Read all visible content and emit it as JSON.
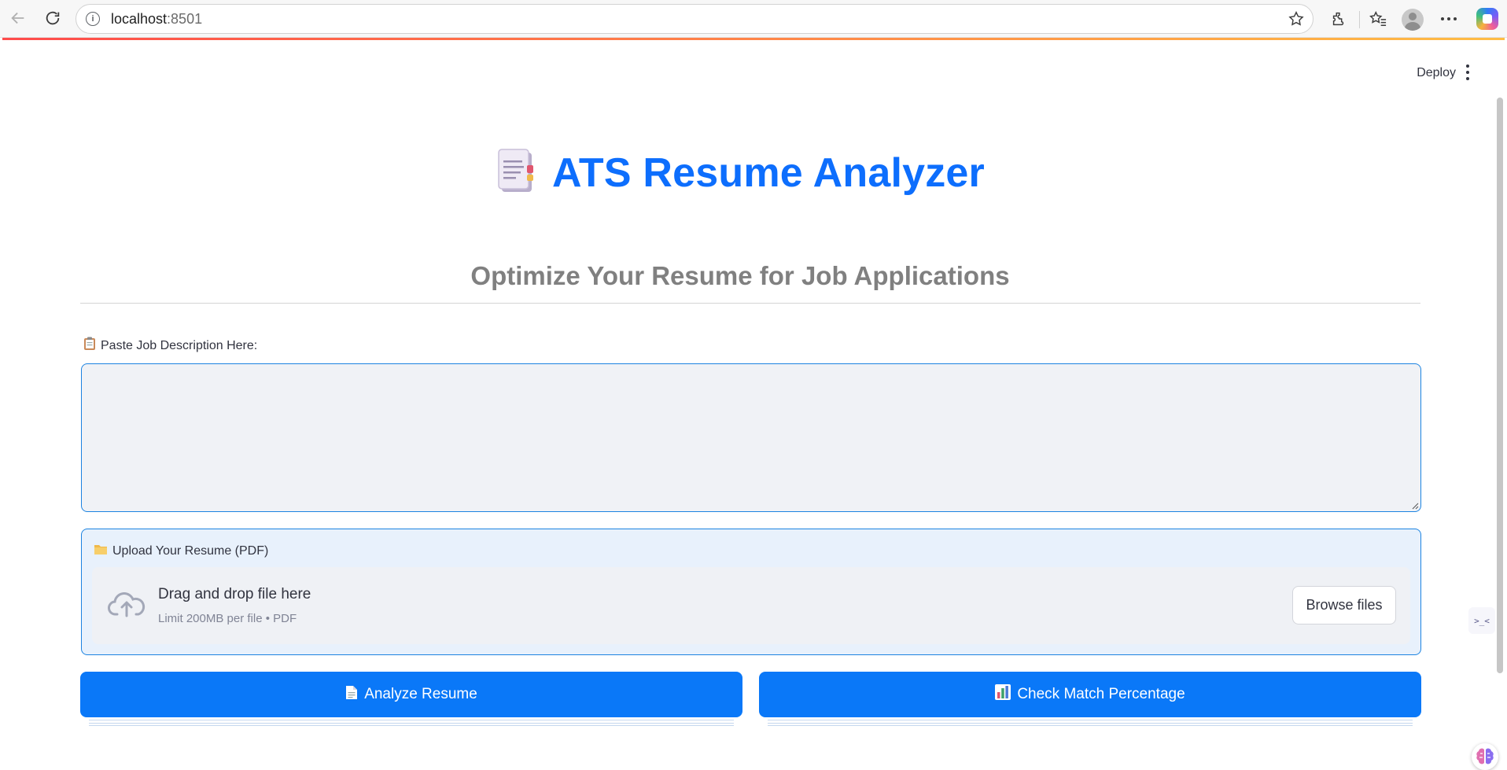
{
  "browser": {
    "url_host": "localhost",
    "url_port": ":8501"
  },
  "header": {
    "deploy_label": "Deploy"
  },
  "main": {
    "title": "ATS Resume Analyzer",
    "subtitle": "Optimize Your Resume for Job Applications",
    "job_description": {
      "label": "Paste Job Description Here:",
      "value": ""
    },
    "uploader": {
      "label": "Upload Your Resume (PDF)",
      "drop_text": "Drag and drop file here",
      "limit_text": "Limit 200MB per file • PDF",
      "browse_label": "Browse files"
    },
    "buttons": {
      "analyze_label": "Analyze Resume",
      "match_label": "Check Match Percentage"
    }
  },
  "colors": {
    "primary": "#0a78f8",
    "title": "#0d6efd",
    "subtitle": "#808080",
    "focus_border": "#1c83e1"
  }
}
